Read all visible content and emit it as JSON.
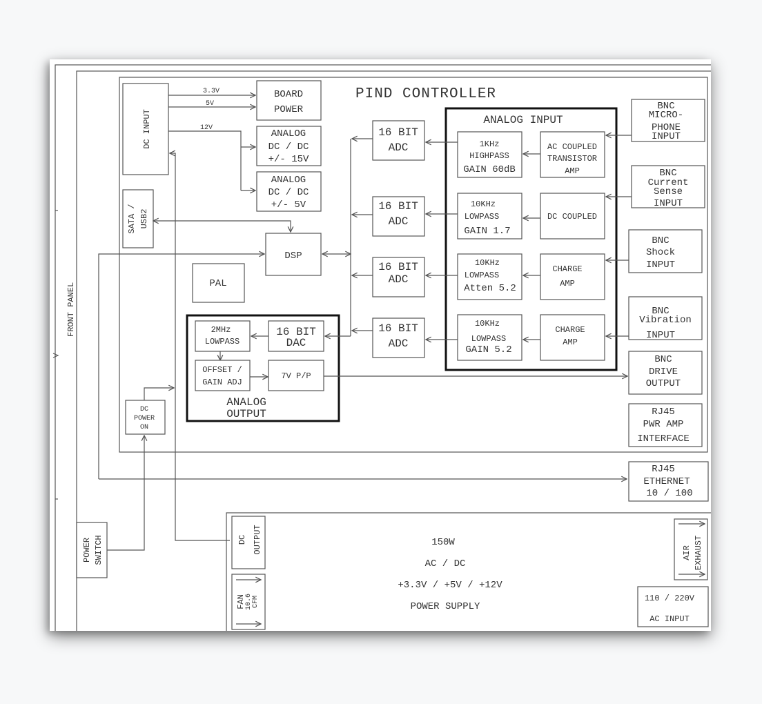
{
  "diagram": {
    "title": "PIND CONTROLLER",
    "front_panel_label": "FRONT PANEL",
    "power_rails": [
      "3.3V",
      "5V",
      "12V"
    ],
    "blocks": {
      "dc_input": "DC INPUT",
      "board_power": [
        "BOARD",
        "POWER"
      ],
      "analog_dcdc_15": [
        "ANALOG",
        "DC / DC",
        "+/- 15V"
      ],
      "analog_dcdc_5": [
        "ANALOG",
        "DC / DC",
        "+/- 5V"
      ],
      "sata_usb": [
        "SATA /",
        "USB2"
      ],
      "dsp": "DSP",
      "pal": "PAL",
      "adc": [
        "16 BIT",
        "ADC"
      ],
      "dac": [
        "16 BIT",
        "DAC"
      ],
      "lowpass_2mhz": [
        "2MHz",
        "LOWPASS"
      ],
      "offset_gain": [
        "OFFSET /",
        "GAIN ADJ"
      ],
      "vpp": "7V P/P",
      "analog_output_label": [
        "ANALOG",
        "OUTPUT"
      ],
      "dc_power_on": [
        "DC",
        "POWER",
        "ON"
      ],
      "power_switch": [
        "POWER",
        "SWITCH"
      ],
      "analog_input_label": "ANALOG  INPUT",
      "filters": [
        [
          "1KHz",
          "HIGHPASS",
          "GAIN 60dB"
        ],
        [
          "10KHz",
          "LOWPASS",
          "GAIN 1.7"
        ],
        [
          "10KHz",
          "LOWPASS",
          "Atten 5.2"
        ],
        [
          "10KHz",
          "LOWPASS",
          "GAIN 5.2"
        ]
      ],
      "amps": [
        [
          "AC COUPLED",
          "TRANSISTOR",
          "AMP"
        ],
        [
          "DC COUPLED"
        ],
        [
          "CHARGE",
          "AMP"
        ],
        [
          "CHARGE",
          "AMP"
        ]
      ],
      "connectors": [
        [
          "BNC",
          "MICRO-",
          "PHONE",
          "INPUT"
        ],
        [
          "BNC",
          "Current",
          "Sense",
          "INPUT"
        ],
        [
          "BNC",
          "Shock",
          "INPUT"
        ],
        [
          "BNC",
          "Vibration",
          "INPUT"
        ],
        [
          "BNC",
          "DRIVE",
          "OUTPUT"
        ],
        [
          "RJ45",
          "PWR AMP",
          "INTERFACE"
        ],
        [
          "RJ45",
          "ETHERNET",
          "10 / 100"
        ]
      ]
    },
    "power_supply": {
      "lines": [
        "150W",
        "AC / DC",
        "+3.3V / +5V / +12V",
        "POWER SUPPLY"
      ],
      "dc_output": [
        "DC",
        "OUTPUT"
      ],
      "fan": [
        "FAN",
        "10.6",
        "CFM"
      ],
      "air_exhaust": [
        "AIR",
        "EXHAUST"
      ],
      "ac_input": [
        "110 / 220V",
        "AC INPUT"
      ]
    }
  }
}
